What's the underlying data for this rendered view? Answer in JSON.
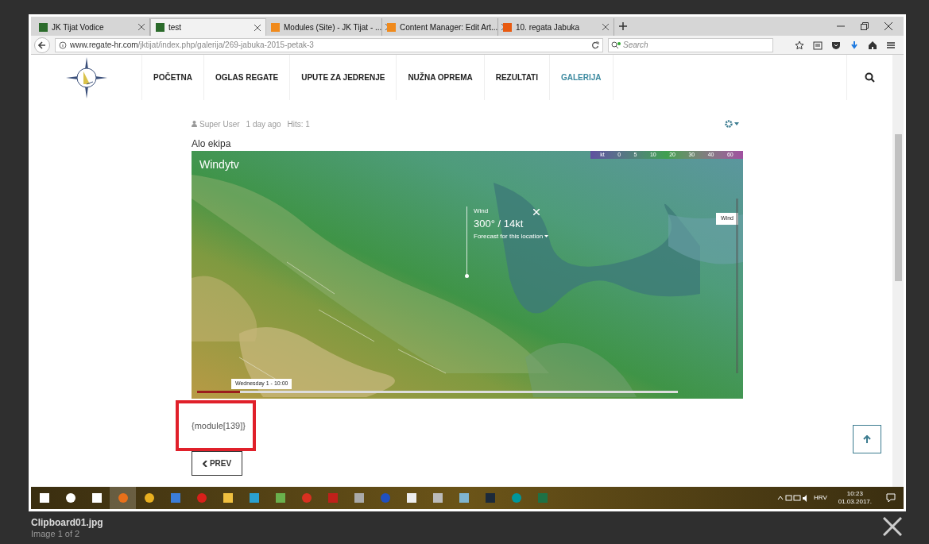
{
  "browser": {
    "tabs": [
      {
        "title": "JK Tijat Vodice",
        "selected": false
      },
      {
        "title": "test",
        "selected": true
      },
      {
        "title": "Modules (Site) - JK Tijat - ...",
        "selected": false
      },
      {
        "title": "Content Manager: Edit Art...",
        "selected": false
      },
      {
        "title": "10. regata Jabuka",
        "selected": false
      }
    ],
    "url_domain": "www.regate-hr.com",
    "url_path": "/jktijat/index.php/galerija/269-jabuka-2015-petak-3",
    "search": {
      "placeholder": "Search"
    }
  },
  "site": {
    "nav": [
      {
        "label": "POČETNA",
        "selected": false
      },
      {
        "label": "OGLAS REGATE",
        "selected": false
      },
      {
        "label": "UPUTE ZA JEDRENJE",
        "selected": false
      },
      {
        "label": "NUŽNA OPREMA",
        "selected": false
      },
      {
        "label": "REZULTATI",
        "selected": false
      },
      {
        "label": "GALERIJA",
        "selected": true
      }
    ]
  },
  "article": {
    "author": "Super User",
    "time": "1 day ago",
    "hits": "Hits: 1",
    "intro": "Alo ekipa",
    "map": {
      "logo": "Windytv",
      "legend": {
        "unit": "kt",
        "values": [
          "0",
          "5",
          "10",
          "20",
          "30",
          "40",
          "60"
        ]
      },
      "popup": {
        "title": "Wind",
        "value": "300° / 14kt",
        "link": "Forecast for this location"
      },
      "layer": "Wind",
      "timeline": {
        "label": "Wednesday 1 - 10:00",
        "level": 0.09
      }
    },
    "module": "{module[139]}",
    "prev": "PREV"
  },
  "taskbar": {
    "language": "HRV",
    "time": "10:23",
    "date": "01.03.2017."
  },
  "lightbox": {
    "filename": "Clipboard01.jpg",
    "counter": "Image 1 of 2"
  }
}
